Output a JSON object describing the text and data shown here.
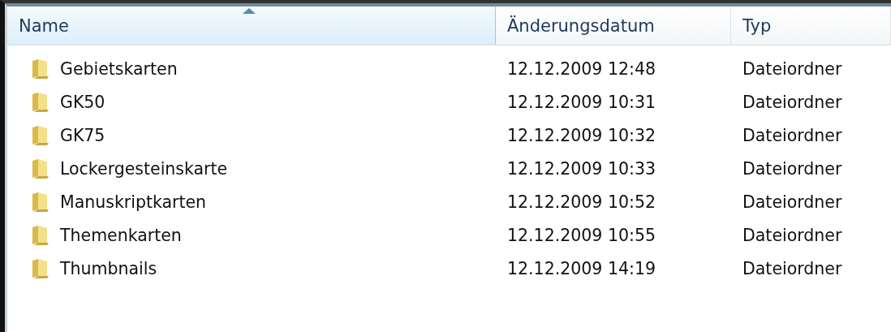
{
  "columns": [
    {
      "label": "Name",
      "sorted": true
    },
    {
      "label": "Änderungsdatum",
      "sorted": false
    },
    {
      "label": "Typ",
      "sorted": false
    }
  ],
  "rows": [
    {
      "name": "Gebietskarten",
      "date": "12.12.2009 12:48",
      "type": "Dateiordner"
    },
    {
      "name": "GK50",
      "date": "12.12.2009 10:31",
      "type": "Dateiordner"
    },
    {
      "name": "GK75",
      "date": "12.12.2009 10:32",
      "type": "Dateiordner"
    },
    {
      "name": "Lockergesteinskarte",
      "date": "12.12.2009 10:33",
      "type": "Dateiordner"
    },
    {
      "name": "Manuskriptkarten",
      "date": "12.12.2009 10:52",
      "type": "Dateiordner"
    },
    {
      "name": "Themenkarten",
      "date": "12.12.2009 10:55",
      "type": "Dateiordner"
    },
    {
      "name": "Thumbnails",
      "date": "12.12.2009 14:19",
      "type": "Dateiordner"
    }
  ]
}
